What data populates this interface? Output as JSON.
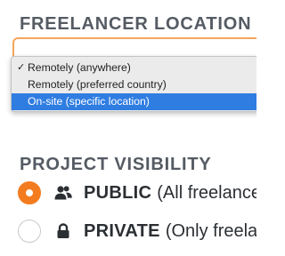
{
  "freelancer_location": {
    "heading": "FREELANCER LOCATION",
    "options": [
      {
        "label": "Remotely (anywhere)",
        "selected": true,
        "highlighted": false
      },
      {
        "label": "Remotely (preferred country)",
        "selected": false,
        "highlighted": false
      },
      {
        "label": "On-site (specific location)",
        "selected": false,
        "highlighted": true
      }
    ],
    "check_mark": "✓"
  },
  "project_visibility": {
    "heading": "PROJECT VISIBILITY",
    "options": [
      {
        "title": "PUBLIC",
        "description": "(All freelancers",
        "checked": true,
        "icon": "users-icon"
      },
      {
        "title": "PRIVATE",
        "description": "(Only freelancers",
        "checked": false,
        "icon": "lock-icon"
      }
    ]
  },
  "colors": {
    "accent": "#f47c20",
    "focus_border": "#f5a55c",
    "highlight": "#2f7de1",
    "heading_text": "#555b63",
    "body_text": "#2b2f33"
  }
}
